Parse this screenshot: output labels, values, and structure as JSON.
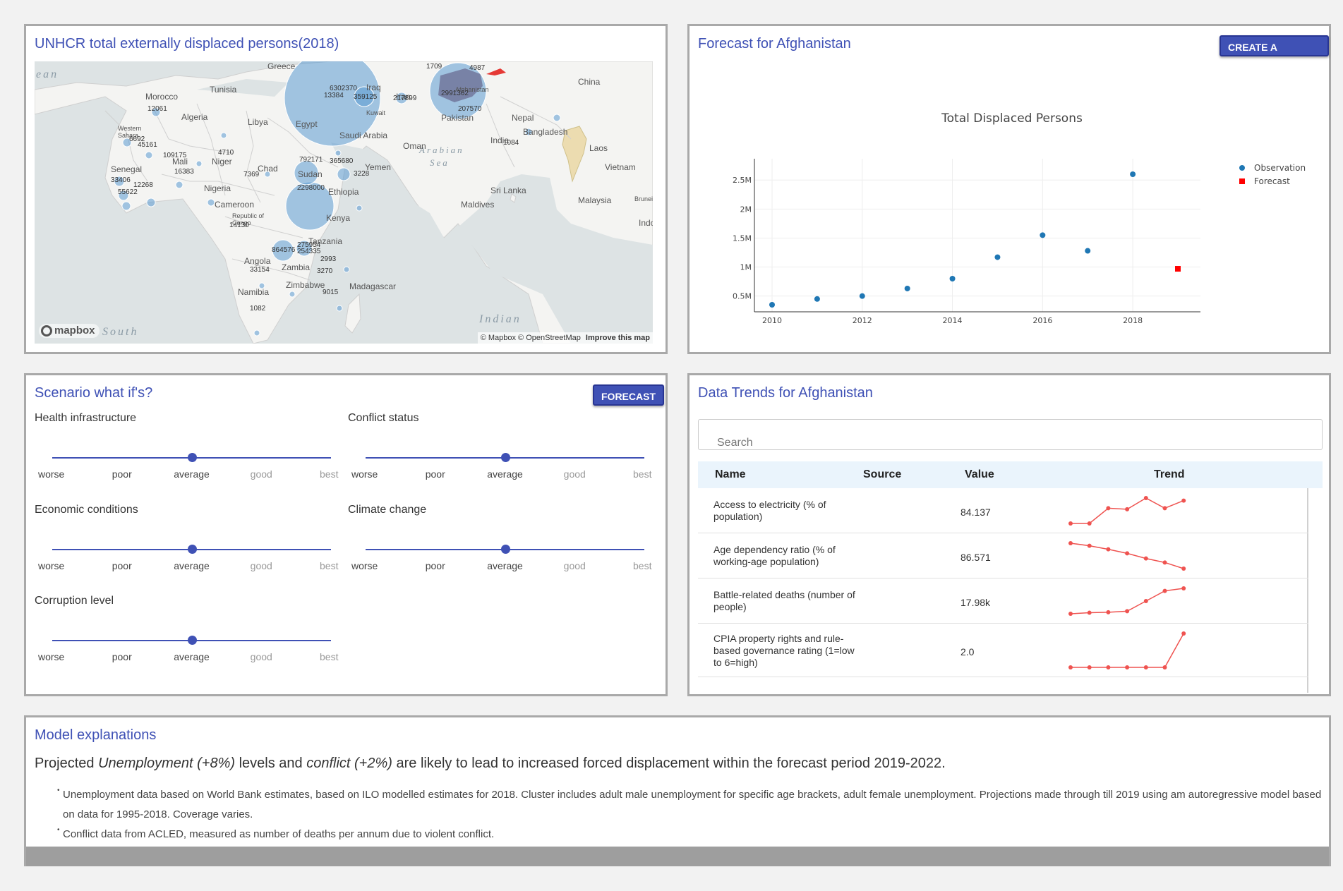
{
  "map_panel": {
    "title": "UNHCR total externally displaced persons(2018)",
    "attribution": "© Mapbox © OpenStreetMap",
    "improve": "Improve this map",
    "logo": "mapbox",
    "seas": [
      "ean",
      "Arabian",
      "Sea",
      "Indian",
      "South"
    ],
    "countries": [
      "Greece",
      "Tunisia",
      "Morocco",
      "Algeria",
      "Libya",
      "Egypt",
      "Iran",
      "Iraq",
      "Kuwait",
      "Saudi Arabia",
      "Oman",
      "Western Sahara",
      "Mali",
      "Niger",
      "Chad",
      "Sudan",
      "Yemen",
      "Senegal",
      "Nigeria",
      "Ethiopia",
      "Cameroon",
      "Republic of Congo",
      "Kenya",
      "Tanzania",
      "Angola",
      "Zambia",
      "Zimbabwe",
      "Namibia",
      "Madagascar",
      "Afghanistan",
      "Pakistan",
      "Nepal",
      "Bangladesh",
      "India",
      "China",
      "Laos",
      "Vietnam",
      "Sri Lanka",
      "Maldives",
      "Malaysia",
      "Brunei",
      "Indonesia"
    ],
    "values": [
      "6302370",
      "13384",
      "359125",
      "217899",
      "2991362",
      "207570",
      "1709",
      "4987",
      "12061",
      "45161",
      "109175",
      "4710",
      "792171",
      "365680",
      "3228",
      "2298000",
      "16383",
      "33406",
      "12268",
      "55622",
      "864576",
      "275954",
      "254335",
      "2993",
      "33154",
      "3270",
      "9015",
      "1082",
      "14130",
      "6692",
      "1084",
      "7369"
    ]
  },
  "forecast_panel": {
    "title": "Forecast for Afghanistan",
    "button": "CREATE A REPORT"
  },
  "chart_data": {
    "type": "scatter",
    "title": "Total Displaced Persons",
    "xlabel": "",
    "ylabel": "",
    "xlim": [
      2009.4,
      2019.5
    ],
    "ylim": [
      0.1,
      2.65
    ],
    "x_ticks": [
      "2010",
      "2012",
      "2014",
      "2016",
      "2018"
    ],
    "x_tick_values": [
      2010,
      2012,
      2014,
      2016,
      2018
    ],
    "y_ticks": [
      "0.5M",
      "1M",
      "1.5M",
      "2M",
      "2.5M"
    ],
    "y_tick_values": [
      0.5,
      1,
      1.5,
      2,
      2.5
    ],
    "grid": true,
    "legend_position": "top-right",
    "series": [
      {
        "name": "Observation",
        "color": "#1f77b4",
        "marker": "circle",
        "x": [
          2010,
          2011,
          2012,
          2013,
          2014,
          2015,
          2016,
          2017,
          2018
        ],
        "y": [
          0.35,
          0.45,
          0.5,
          0.63,
          0.8,
          1.17,
          1.55,
          1.28,
          2.6
        ]
      },
      {
        "name": "Forecast",
        "color": "#ff0000",
        "marker": "square",
        "x": [
          2019
        ],
        "y": [
          0.97
        ]
      }
    ]
  },
  "scenario_panel": {
    "title": "Scenario what if's?",
    "button": "FORECAST",
    "scale": [
      "worse",
      "poor",
      "average",
      "good",
      "best"
    ],
    "sliders": [
      {
        "label": "Health infrastructure",
        "value": "average"
      },
      {
        "label": "Conflict status",
        "value": "average"
      },
      {
        "label": "Economic conditions",
        "value": "average"
      },
      {
        "label": "Climate change",
        "value": "average"
      },
      {
        "label": "Corruption level",
        "value": "average"
      }
    ]
  },
  "trends_panel": {
    "title": "Data Trends for Afghanistan",
    "search_placeholder": "Search",
    "columns": [
      "Name",
      "Source",
      "Value",
      "Trend"
    ],
    "trend_color": "#ef5350",
    "rows": [
      {
        "name": "Access to electricity (% of population)",
        "source": "",
        "value": "84.137",
        "trend": [
          1,
          1,
          4,
          3.8,
          6,
          4,
          5.5
        ]
      },
      {
        "name": "Age dependency ratio (% of working-age population)",
        "source": "",
        "value": "86.571",
        "trend": [
          6,
          5.5,
          4.8,
          4,
          3,
          2.2,
          1
        ]
      },
      {
        "name": "Battle-related deaths (number of people)",
        "source": "",
        "value": "17.98k",
        "trend": [
          1,
          1.2,
          1.3,
          1.5,
          3.5,
          5.5,
          6
        ]
      },
      {
        "name": "CPIA property rights and rule-based governance rating (1=low to 6=high)",
        "source": "",
        "value": "2.0",
        "trend": [
          1,
          1,
          1,
          1,
          1,
          1,
          3
        ]
      }
    ]
  },
  "explanations_panel": {
    "title": "Model explanations",
    "summary_1": "Projected ",
    "summary_em1": "Unemployment (+8%)",
    "summary_2": " levels and ",
    "summary_em2": "conflict (+2%)",
    "summary_3": " are likely to lead to increased forced displacement within the forecast period 2019-2022.",
    "bullets": [
      "Unemployment data based on World Bank estimates, based on ILO modelled estimates for 2018. Cluster includes adult male unemployment for specific age brackets, adult female unemployment. Projections made through till 2019 using am autoregressive model based on data for 1995-2018. Coverage varies.",
      "Conflict data from ACLED, measured as number of deaths per annum due to violent conflict."
    ]
  }
}
